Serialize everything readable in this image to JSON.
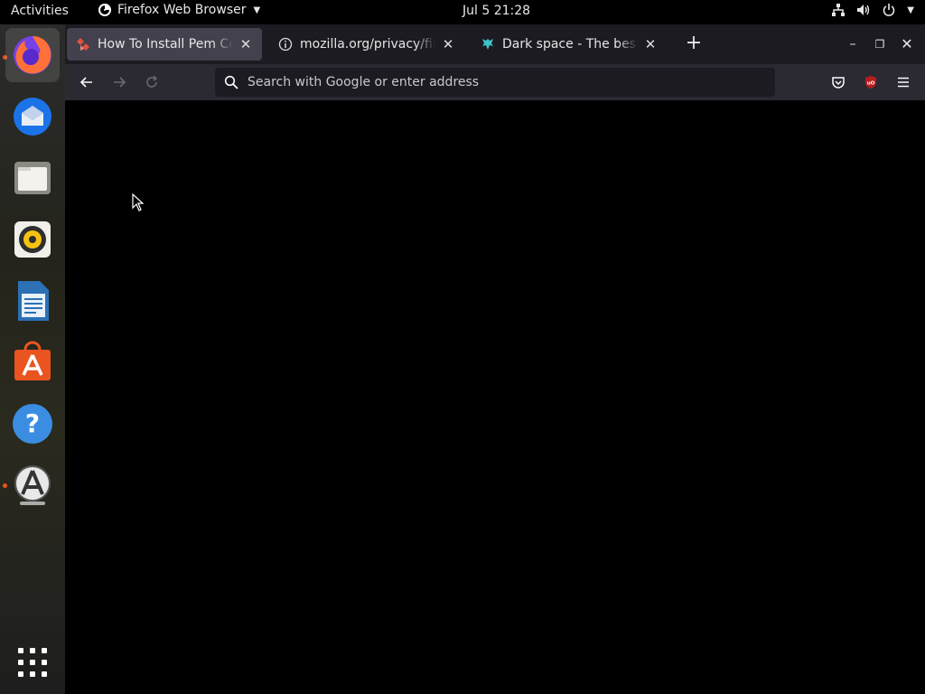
{
  "topbar": {
    "activities": "Activities",
    "app_name": "Firefox Web Browser",
    "clock": "Jul 5  21:28"
  },
  "dock": {
    "items": [
      {
        "name": "firefox",
        "running": true
      },
      {
        "name": "thunderbird",
        "running": false
      },
      {
        "name": "files",
        "running": false
      },
      {
        "name": "rhythmbox",
        "running": false
      },
      {
        "name": "libreoffice-writer",
        "running": false
      },
      {
        "name": "ubuntu-software",
        "running": false
      },
      {
        "name": "help",
        "running": false
      },
      {
        "name": "software-updater",
        "running": true
      },
      {
        "name": "show-applications",
        "running": false
      }
    ]
  },
  "browser": {
    "tabs": [
      {
        "title": "How To Install Pem Certificate",
        "selected": true,
        "icon": "diamond-favicon"
      },
      {
        "title": "mozilla.org/privacy/firefox",
        "selected": false,
        "icon": "info-icon"
      },
      {
        "title": "Dark space - The best dynamic",
        "selected": false,
        "icon": "ram-favicon"
      }
    ],
    "urlbar": {
      "placeholder": "Search with Google or enter address",
      "value": ""
    }
  },
  "colors": {
    "accent": "#e95420",
    "tab_bg": "#1c1b22",
    "toolbar_bg": "#2b2a33",
    "selected_tab": "#42414d"
  }
}
